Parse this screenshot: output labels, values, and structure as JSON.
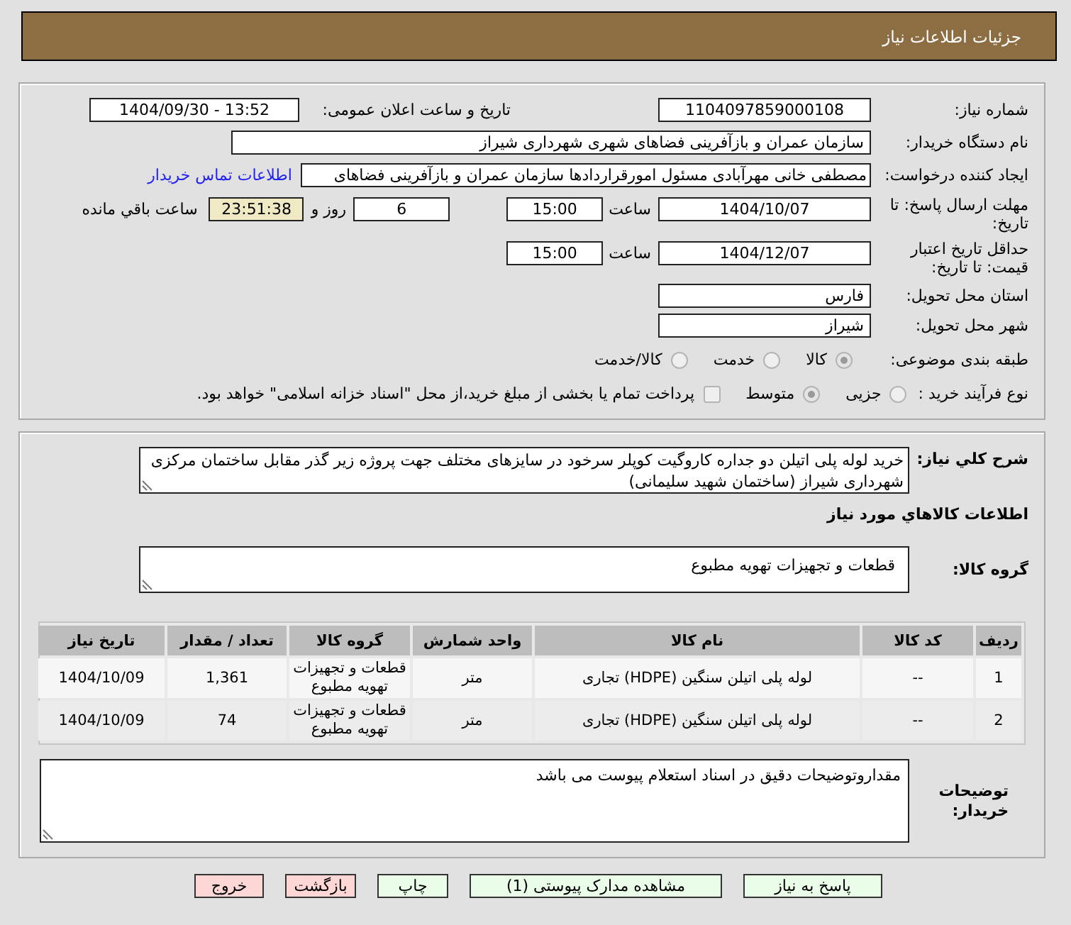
{
  "header": {
    "title": "جزئیات اطلاعات نیاز"
  },
  "details": {
    "need_number": {
      "label": "شماره نیاز:",
      "value": "1104097859000108"
    },
    "announcement": {
      "label": "تاریخ و ساعت اعلان عمومی:",
      "value": "1404/09/30 - 13:52"
    },
    "buyer_organization": {
      "label": "نام دستگاه خریدار:",
      "value": "سازمان عمران و بازآفرینی فضاهای شهری شهرداری شیراز"
    },
    "requester": {
      "label": "ایجاد کننده درخواست:",
      "value": "مصطفی خانی مهرآبادی مسئول امورقراردادها سازمان عمران و بازآفرینی فضاهای",
      "contact_link": "اطلاعات تماس خریدار"
    },
    "response_deadline": {
      "label": "مهلت ارسال پاسخ: تا تاریخ:",
      "date": "1404/10/07",
      "time_label": "ساعت",
      "time": "15:00",
      "days": "6",
      "days_label": "روز و",
      "remaining": "23:51:38",
      "remaining_label": "ساعت باقي مانده"
    },
    "price_validity": {
      "label": "حداقل تاریخ اعتبار قیمت: تا تاریخ:",
      "date": "1404/12/07",
      "time_label": "ساعت",
      "time": "15:00"
    },
    "delivery_province": {
      "label": "استان محل تحویل:",
      "value": "فارس"
    },
    "delivery_city": {
      "label": "شهر محل تحویل:",
      "value": "شیراز"
    },
    "subject_category": {
      "label": "طبقه بندی موضوعی:",
      "options": [
        {
          "label": "کالا",
          "selected": true
        },
        {
          "label": "خدمت",
          "selected": false
        },
        {
          "label": "کالا/خدمت",
          "selected": false
        }
      ]
    },
    "purchase_process": {
      "label": "نوع فرآیند خرید :",
      "options": [
        {
          "label": "جزیی",
          "selected": false
        },
        {
          "label": "متوسط",
          "selected": true
        }
      ],
      "treasury_payment": {
        "label": "پرداخت تمام یا بخشی از مبلغ خرید،از محل \"اسناد خزانه اسلامی\" خواهد بود.",
        "checked": false
      }
    }
  },
  "need_description": {
    "label": "شرح کلي نیاز:",
    "value": "خرید لوله پلی اتیلن دو جداره کاروگیت کوپلر سرخود در سایزهای مختلف جهت پروژه زیر گذر مقابل ساختمان مرکزی شهرداری شیراز (ساختمان شهید سلیمانی)"
  },
  "goods": {
    "title": "اطلاعات کالاهاي مورد نیاز",
    "group": {
      "label": "گروه کالا:",
      "value": "قطعات و تجهیزات تهویه مطبوع"
    },
    "table": {
      "columns": [
        "ردیف",
        "کد کالا",
        "نام کالا",
        "واحد شمارش",
        "گروه کالا",
        "تعداد / مقدار",
        "تاریخ نیاز"
      ],
      "rows": [
        [
          "1",
          "--",
          "لوله پلی اتیلن سنگین (HDPE) تجاری",
          "متر",
          "قطعات و تجهیزات تهویه مطبوع",
          "1,361",
          "1404/10/09"
        ],
        [
          "2",
          "--",
          "لوله پلی اتیلن سنگین (HDPE) تجاری",
          "متر",
          "قطعات و تجهیزات تهویه مطبوع",
          "74",
          "1404/10/09"
        ]
      ]
    }
  },
  "buyer_notes": {
    "label": "توضیحات خریدار:",
    "value": "مقداروتوضیحات دقیق در اسناد استعلام پیوست می باشد"
  },
  "buttons": [
    {
      "label": "پاسخ به نیاز",
      "kind": "action"
    },
    {
      "label": "مشاهده مدارک پیوستی (1)",
      "kind": "action"
    },
    {
      "label": "چاپ",
      "kind": "action"
    },
    {
      "label": "بازگشت",
      "kind": "exit"
    },
    {
      "label": "خروج",
      "kind": "exit"
    }
  ]
}
